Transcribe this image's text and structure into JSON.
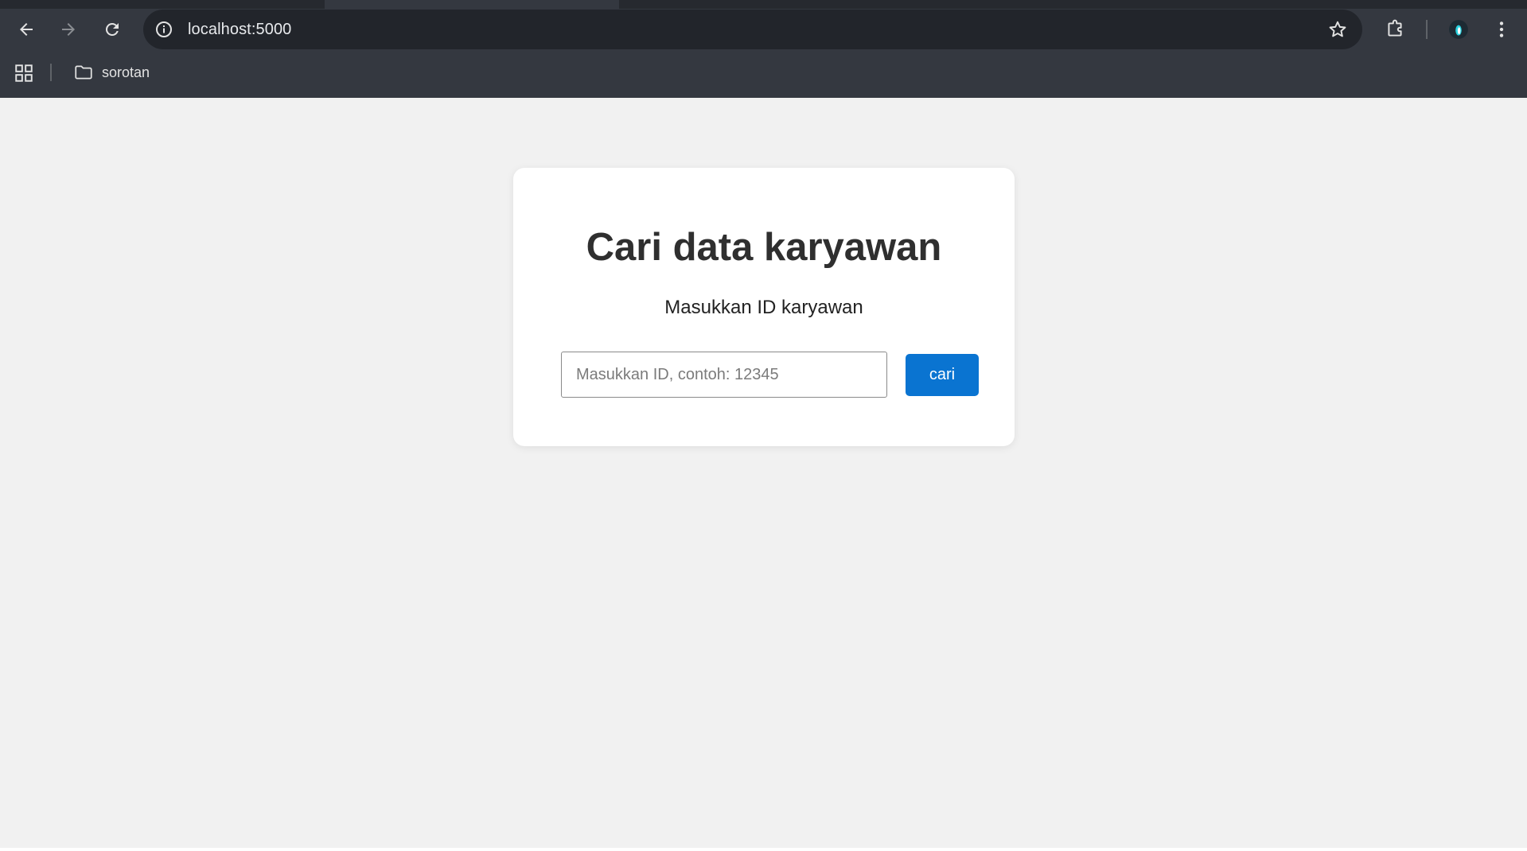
{
  "browser": {
    "url": "localhost:5000",
    "bookmarks": [
      {
        "label": "sorotan",
        "icon": "folder-icon"
      }
    ],
    "icons": {
      "back": "arrow-left-icon",
      "forward": "arrow-right-icon",
      "reload": "reload-icon",
      "site_info": "info-icon",
      "bookmark_star": "star-icon",
      "extensions": "puzzle-icon",
      "profile": "avatar",
      "menu": "kebab-menu-icon",
      "apps": "apps-grid-icon"
    },
    "colors": {
      "chrome_bg": "#343840",
      "omnibox_bg": "#22252b"
    }
  },
  "page": {
    "title": "Cari data karyawan",
    "subtitle": "Masukkan ID karyawan",
    "search": {
      "placeholder": "Masukkan ID, contoh: 12345",
      "value": ""
    },
    "button_label": "cari",
    "colors": {
      "background": "#f1f1f1",
      "card": "#ffffff",
      "button": "#0a74d1"
    }
  }
}
